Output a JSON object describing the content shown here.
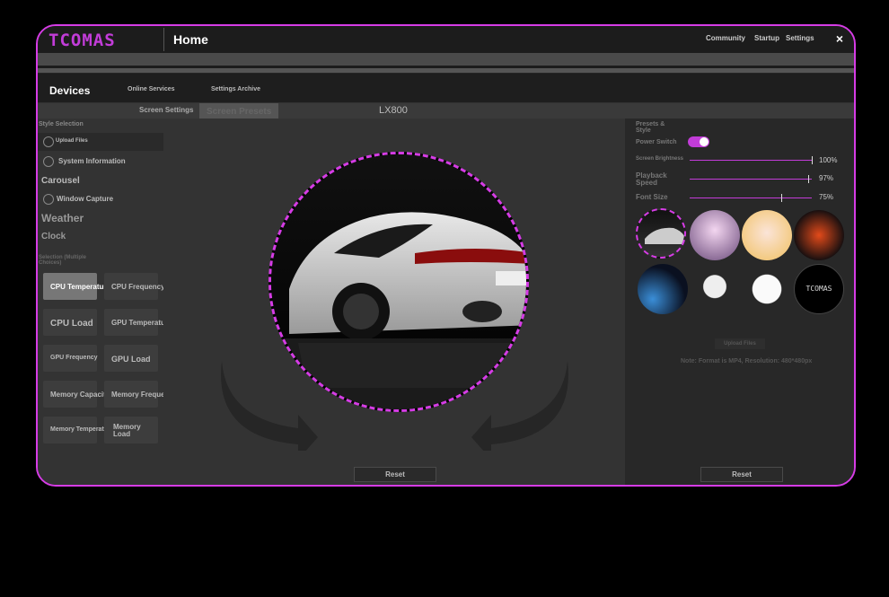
{
  "app": {
    "logo": "TCOMAS",
    "title": "Home",
    "nav": [
      "Community",
      "Startup",
      "Settings"
    ],
    "close": "×"
  },
  "top_tabs": {
    "devices": "Devices",
    "online_services": "Online Services",
    "settings_archive": "Settings Archive"
  },
  "sub_tabs": {
    "item1": "Screen Settings",
    "active": "Screen Presets",
    "model": "LX800"
  },
  "sidebar": {
    "style_selection": "Style Selection",
    "upload_files": "Upload Files",
    "system_information": "System Information",
    "carousel": "Carousel",
    "window_capture": "Window Capture",
    "weather": "Weather",
    "clock": "Clock",
    "selection_multiple": "Selection (Multiple Choices)",
    "tiles": [
      "CPU Temperature",
      "CPU Frequency",
      "CPU Load",
      "GPU Temperature",
      "GPU Frequency",
      "GPU Load",
      "Memory Capacity",
      "Memory Frequency",
      "Memory Temperature",
      "Memory Load"
    ]
  },
  "center": {
    "reset": "Reset"
  },
  "right": {
    "presets_style": "Presets & Style",
    "power_switch": "Power Switch",
    "power_on": true,
    "screen_brightness": "Screen Brightness",
    "brightness_value": "100%",
    "brightness_level": 1.0,
    "playback_speed": "Playback Speed",
    "speed_value": "97%",
    "speed_level": 0.97,
    "font_size": "Font Size",
    "font_value": "75%",
    "font_level": 0.75,
    "upload_files": "Upload Files",
    "note": "Note: Format is MP4, Resolution: 480*480px",
    "reset": "Reset"
  },
  "colors": {
    "accent": "#d63ce6",
    "background": "#262626"
  }
}
